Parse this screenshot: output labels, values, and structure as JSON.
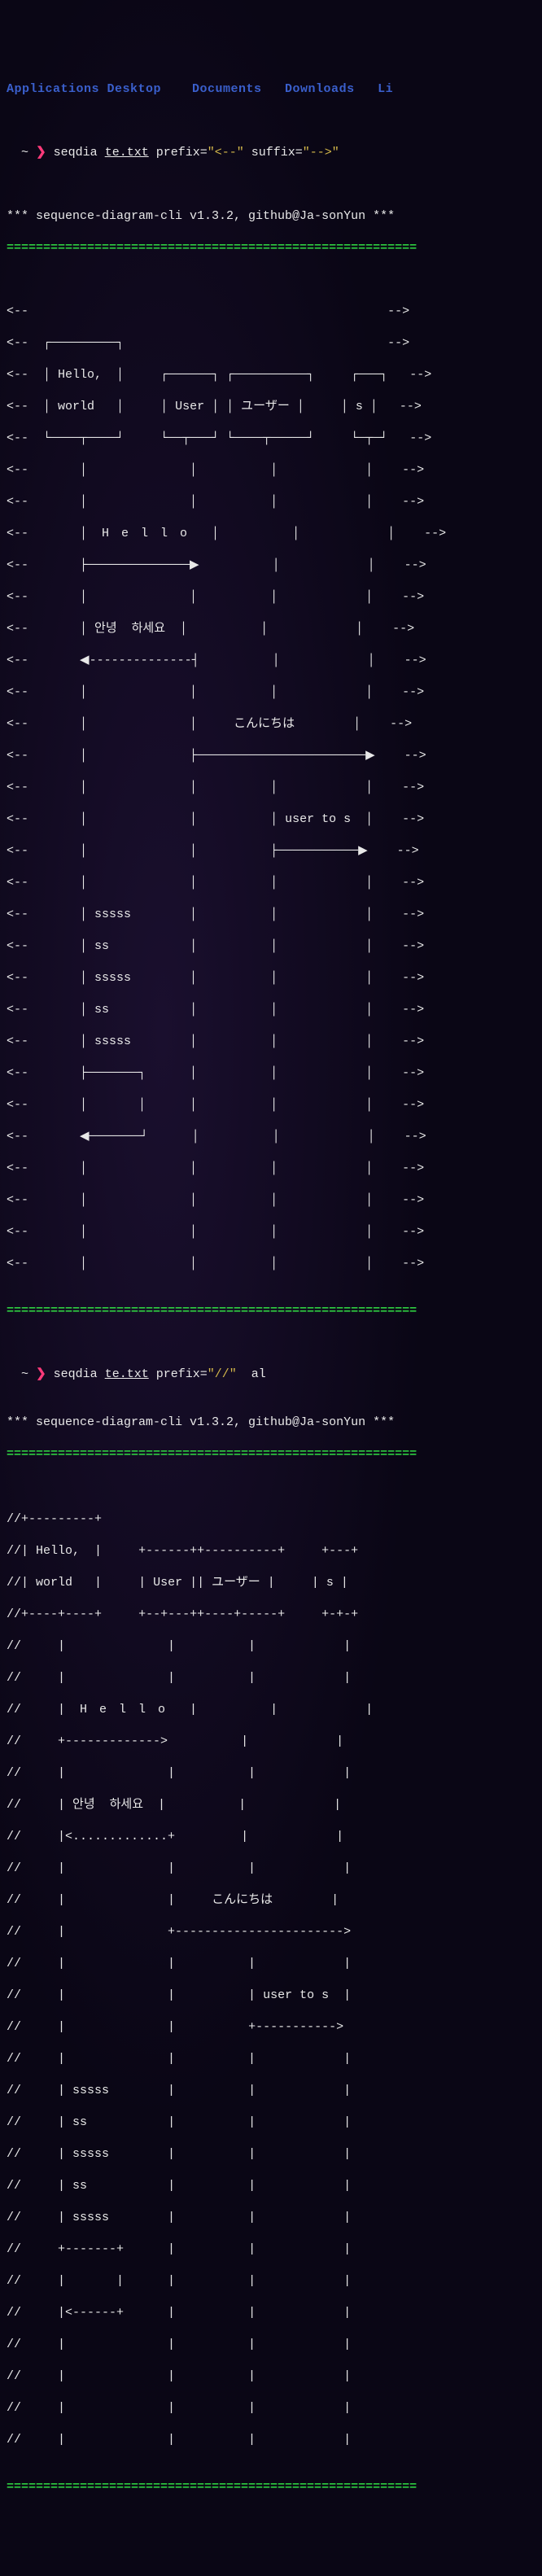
{
  "menubar": "Applications Desktop    Documents   Downloads   Li",
  "prompt": {
    "apple": "",
    "home": "",
    "tilde": "~",
    "arrow": "❯"
  },
  "cmd1": {
    "bin": "seqdia",
    "file": "te.txt",
    "arg_prefix_key": "prefix=",
    "arg_prefix_val": "\"<--\"",
    "arg_suffix_key": "suffix=",
    "arg_suffix_val": "\"-->\""
  },
  "banner": "*** sequence-diagram-cli v1.3.2, github@Ja-sonYun ***",
  "sep": "========================================================",
  "diagram1": {
    "prefix": "<--",
    "suffix": "-->",
    "boxes": {
      "hello_top": "┌─────────┐",
      "hello_l1": "│ Hello,  │",
      "hello_l2": "│ world   │",
      "hello_bot": "└────┬────┘",
      "user_top": "┌──────┐",
      "user_mid": "│ User │",
      "user_bot": "└──┬───┘",
      "jp_top": "┌──────────┐",
      "jp_mid": "│ ユーザー │",
      "jp_bot": "└────┬─────┘",
      "s_top": "┌───┐",
      "s_mid": "│ s │",
      "s_bot": "└─┬─┘"
    },
    "messages": {
      "hello": "H e l l o",
      "annyeong": "안녕  하세요",
      "konnichiwa": "こんにちは",
      "user_to_s": "user to s",
      "sssss": "sssss",
      "ss": "ss"
    },
    "arrows": {
      "solid_r": "──────────────▶",
      "dash_l": "◀--------------",
      "long_r": "───────────────────────▶",
      "short_r": "───────────▶",
      "self_top": "├───────┐",
      "self_mid": "│       │",
      "self_bot": "◀───────┘"
    }
  },
  "cmd2": {
    "bin": "seqdia",
    "file": "te.txt",
    "arg_prefix_key": "prefix=",
    "arg_prefix_val": "\"//\"",
    "arg_tail": "al"
  },
  "diagram2": {
    "prefix": "//",
    "boxes": {
      "hello_top": "+---------+",
      "hello_l1": "| Hello,  |",
      "hello_l2": "| world   |",
      "hello_bot": "+----+----+",
      "user_top": "+------+",
      "user_mid": "| User |",
      "user_bot": "+--+---+",
      "jp_top": "+----------+",
      "jp_mid": "| ユーザー |",
      "jp_bot": "+----+-----+",
      "s_top": "+---+",
      "s_mid": "| s |",
      "s_bot": "+-+-+"
    },
    "messages": {
      "hello": "H e l l o",
      "annyeong": "안녕  하세요",
      "konnichiwa": "こんにちは",
      "user_to_s": "user to s",
      "sssss": "sssss",
      "ss": "ss"
    },
    "arrows": {
      "solid_r": "+------------->",
      "dash_l": "|<.............+",
      "long_r": "+----------------------->",
      "short_r": "+----------->",
      "self_top": "+-------+",
      "self_mid": "|       |",
      "self_bot": "|<------+"
    }
  }
}
